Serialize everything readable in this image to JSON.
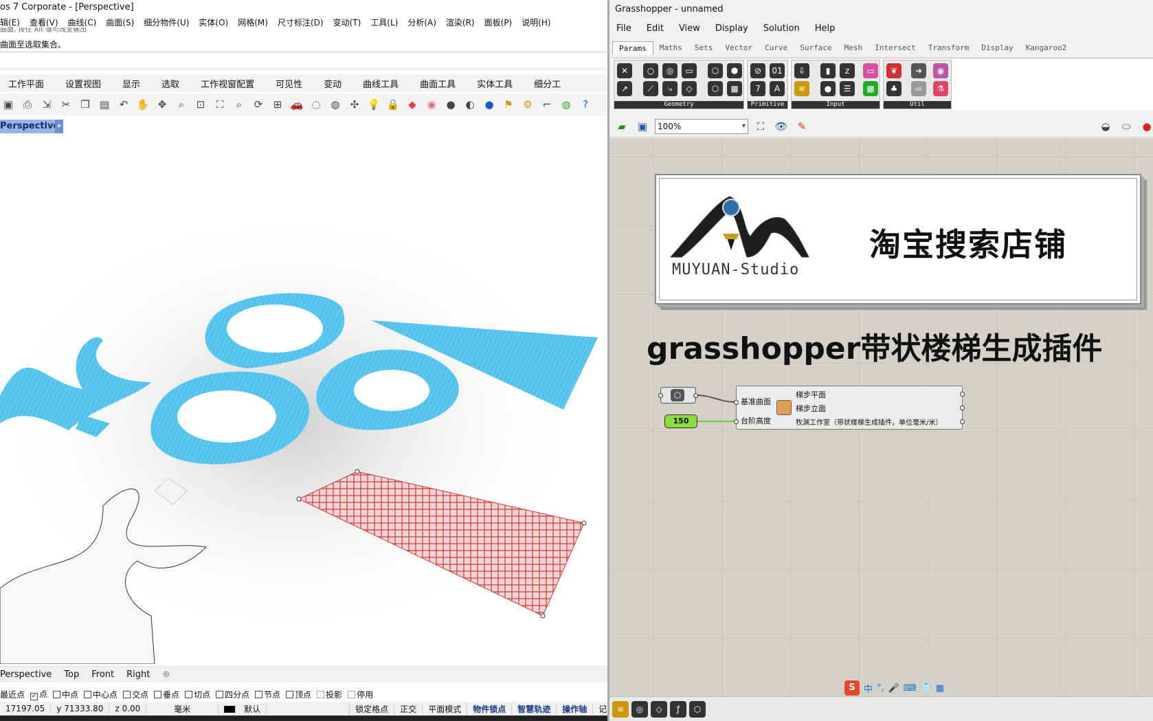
{
  "rhino": {
    "title": "os 7 Corporate - [Perspective]",
    "menu": [
      "辑(E)",
      "查看(V)",
      "曲线(C)",
      "曲面(S)",
      "细分物件(U)",
      "实体(O)",
      "网格(M)",
      "尺寸标注(D)",
      "变动(T)",
      "工具(L)",
      "分析(A)",
      "渲染(R)",
      "面板(P)",
      "说明(H)"
    ],
    "command_history_clipped": "曲面, 按住 Alt 键可改变输出",
    "command_prompt": "曲面至选取集合。",
    "toolbar_tabs": [
      "工作平面",
      "设置视图",
      "显示",
      "选取",
      "工作视窗配置",
      "可见性",
      "变动",
      "曲线工具",
      "曲面工具",
      "实体工具",
      "细分工"
    ],
    "toolbar_icons": [
      "save-icon",
      "print-icon",
      "import-icon",
      "cut-icon",
      "copy-icon",
      "paste-icon",
      "undo-icon",
      "pan-icon",
      "move-icon",
      "zoom-icon",
      "zoom-window-icon",
      "zoom-extents-icon",
      "zoom-selected-icon",
      "rotate-view-icon",
      "four-view-icon",
      "car-icon",
      "hide-icon",
      "show-icon",
      "gumball-icon",
      "light-icon",
      "lock-icon",
      "layer-icon",
      "color-wheel-icon",
      "sphere-icon",
      "material-icon",
      "render-icon",
      "flag-icon",
      "options-icon",
      "dimension-icon",
      "globe-icon",
      "help-icon"
    ],
    "viewport_title": "Perspective",
    "viewport_tabs": [
      "Perspective",
      "Top",
      "Front",
      "Right"
    ],
    "add_tab_icon": "plus-icon",
    "osnaps": [
      {
        "label": "最近点",
        "checked": false
      },
      {
        "label": "点",
        "checked": true
      },
      {
        "label": "中点",
        "checked": false
      },
      {
        "label": "中心点",
        "checked": false
      },
      {
        "label": "交点",
        "checked": false
      },
      {
        "label": "垂点",
        "checked": false
      },
      {
        "label": "切点",
        "checked": false
      },
      {
        "label": "四分点",
        "checked": false
      },
      {
        "label": "节点",
        "checked": false
      },
      {
        "label": "顶点",
        "checked": false
      },
      {
        "label": "投影",
        "checked": false
      },
      {
        "label": "停用",
        "checked": false
      }
    ],
    "status": {
      "x": "17197.05",
      "y": "y 71333.80",
      "z": "z 0.00",
      "units": "毫米",
      "layer": "默认",
      "lock_grid": "锁定格点",
      "ortho": "正交",
      "planar": "平面模式",
      "osnap": "物件锁点",
      "smarttrack": "智慧轨迹",
      "gumball": "操作轴",
      "history": "记录建"
    }
  },
  "grasshopper": {
    "title": "Grasshopper - unnamed",
    "menu": [
      "File",
      "Edit",
      "View",
      "Display",
      "Solution",
      "Help"
    ],
    "category_tabs": [
      "Params",
      "Maths",
      "Sets",
      "Vector",
      "Curve",
      "Surface",
      "Mesh",
      "Intersect",
      "Transform",
      "Display",
      "Kangaroo2"
    ],
    "ribbon_groups": [
      "Geometry",
      "Primitive",
      "Input",
      "Util"
    ],
    "zoom": "100%",
    "banner_text": "淘宝搜索店铺",
    "logo_caption": "MUYUAN-Studio",
    "headline": "grasshopper带状楼梯生成插件",
    "component": {
      "inputs": [
        "基准曲面",
        "台阶高度"
      ],
      "outputs": [
        "梯步平面",
        "梯步立面",
        "牧渊工作室（带状楼梯生成插件，单位毫米/米）"
      ]
    },
    "slider_value": "150",
    "ime": {
      "logo": "S",
      "lang": "中"
    },
    "colors": {
      "slider": "#8bdc3c",
      "surface_blue": "#4ec2ee",
      "surface_red": "#d23a3a",
      "canvas": "#d4d2c8"
    }
  }
}
